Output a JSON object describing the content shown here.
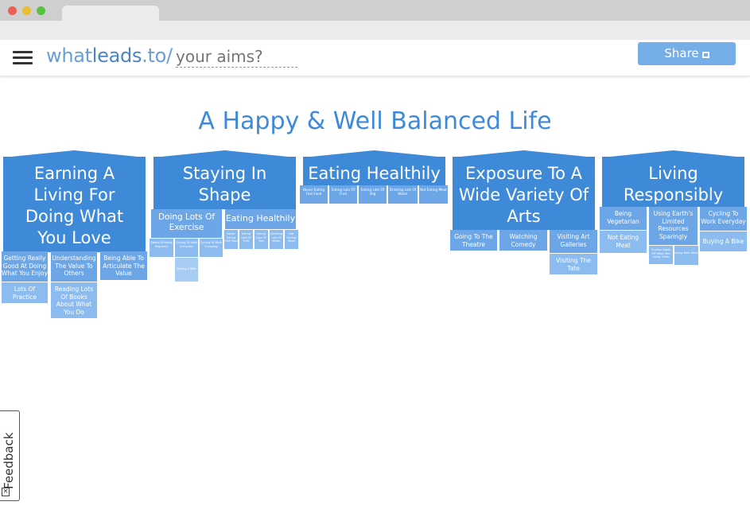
{
  "header": {
    "brand_a": "what",
    "brand_b": "leads",
    "brand_c": ".to/",
    "aims_placeholder": "your aims?",
    "share_label": "Share"
  },
  "title": "A Happy & Well Balanced Life",
  "aims": [
    {
      "label": "Earning A Living For Doing What You Love",
      "subs": [
        "Getting Really Good At Doing What You Enjoy",
        "Understanding The Value To Others",
        "Being Able To Articulate The Value",
        "Lots Of Practice",
        "Reading Lots Of Books About What You Do"
      ]
    },
    {
      "label": "Staying In Shape",
      "subs": [
        "Doing Lots Of Exercise",
        "Eating Healthily",
        "Eating Drinking Regularly",
        "Cycling To Work Everyday",
        "Cycling To Work Everyday",
        "Buying A Bike",
        "Never Eating Fast Food",
        "Eating Lots Of Fruit",
        "Eating Lots Of Veg",
        "Drinking Lots Of Water",
        "Not Eating Meat"
      ]
    },
    {
      "label": "Eating Healthily",
      "subs": [
        "Never Eating Fast Food",
        "Eating Lots Of Fruit",
        "Eating Lots Of Veg",
        "Drinking Lots Of Water",
        "Not Eating Meat"
      ]
    },
    {
      "label": "Exposure To A Wide Variety Of Arts",
      "subs": [
        "Going To The Theatre",
        "Watching Comedy",
        "Visiting Art Galleries",
        "Visiting The Tate"
      ]
    },
    {
      "label": "Living Responsibly",
      "subs": [
        "Being Vegetarian",
        "Using Earth's Limited Resources Sparingly",
        "Cycling To Work Everyday",
        "Not Eating Meat",
        "Buying A Bike",
        "Turning Lights Off When Not Using Them",
        "Living Near Work"
      ]
    }
  ],
  "feedback": {
    "label": "Feedback",
    "close": "×"
  },
  "colors": {
    "primary": "#3f8ad8",
    "level2": "#6da6e6",
    "level3": "#8cbcef",
    "level4": "#a8cdf3",
    "share": "#76aee8"
  }
}
